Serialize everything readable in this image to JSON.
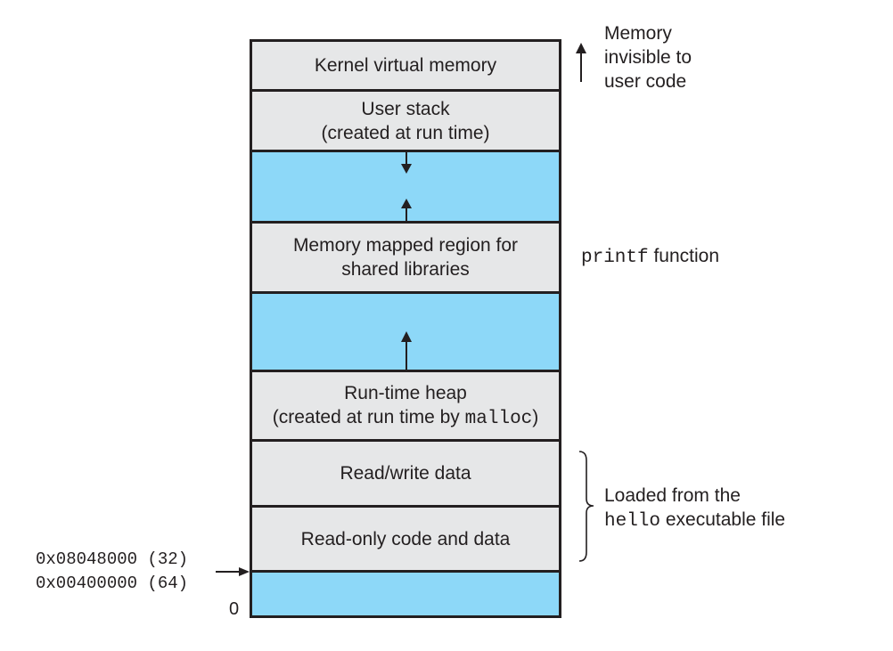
{
  "segments": {
    "kernel": "Kernel virtual memory",
    "user_stack_1": "User stack",
    "user_stack_2": "(created at run time)",
    "mmap_1": "Memory mapped region for",
    "mmap_2": "shared libraries",
    "heap_1": "Run-time heap",
    "heap_2_prefix": "(created at run time by ",
    "heap_2_code": "malloc",
    "heap_2_suffix": ")",
    "rw": "Read/write data",
    "ro": "Read-only code and data"
  },
  "annotations": {
    "invisible": [
      "Memory",
      "invisible to",
      "user code"
    ],
    "printf_code": "printf",
    "printf_text": " function",
    "loaded_1": "Loaded from the",
    "loaded_2_code": "hello",
    "loaded_2_text": " executable file"
  },
  "addresses": {
    "addr32": "0x08048000 (32)",
    "addr64": "0x00400000 (64)",
    "zero": "0"
  },
  "colors": {
    "region": "#e6e7e8",
    "unused": "#8dd8f8",
    "border": "#231f20"
  }
}
